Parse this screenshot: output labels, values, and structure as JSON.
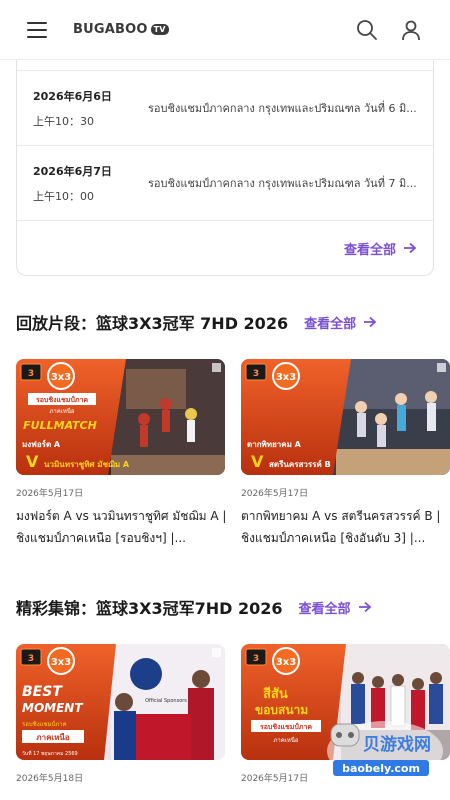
{
  "header": {
    "logo_text": "BUGABOO",
    "logo_badge": "TV"
  },
  "schedule": {
    "rows": [
      {
        "date": "2026年6月6日",
        "time": "上午10：30",
        "title": "รอบชิงแชมป์ภาคกลาง กรุงเทพและปริมณฑล วันที่ 6 มิ..."
      },
      {
        "date": "2026年6月7日",
        "time": "上午10：00",
        "title": "รอบชิงแชมป์ภาคกลาง กรุงเทพและปริมณฑล วันที่ 7 มิ..."
      }
    ],
    "view_all": "查看全部"
  },
  "replay": {
    "title": "回放片段：篮球3X3冠军 7HD 2026",
    "view_all": "查看全部",
    "cards": [
      {
        "date": "2026年5月17日",
        "title": "มงฟอร์ต A vs นวมินทราชูทิศ มัชฌิม A |ชิงแชมป์ภาคเหนือ [รอบชิงฯ] |...",
        "thumb": {
          "banner": "รอบชิงแชมป์ภาค",
          "region": "ภาคเหนือ",
          "tag": "FULLMATCH",
          "team1": "มงฟอร์ต A",
          "team2": "นวมินทราชูทิศ มัชฌิม A"
        }
      },
      {
        "date": "2026年5月17日",
        "title": "ตากพิทยาคม A vs สตรีนครสวรรค์ B |ชิงแชมป์ภาคเหนือ [ชิงอันดับ 3] |...",
        "thumb": {
          "team1": "ตากพิทยาคม A",
          "team2": "สตรีนครสวรรค์ B"
        }
      }
    ]
  },
  "highlights": {
    "title": "精彩集锦：篮球3X3冠军7HD 2026",
    "view_all": "查看全部",
    "cards": [
      {
        "date": "2026年5月18日",
        "thumb": {
          "tag1": "BEST",
          "tag2": "MOMENT",
          "banner": "รอบชิงแชมป์ภาค",
          "region": "ภาคเหนือ",
          "caption": "วันที่ 17 พฤษภาคม 2569",
          "sponsor": "Official Sponsors"
        }
      },
      {
        "date": "2026年5月17日",
        "thumb": {
          "line1": "สีสัน",
          "line2": "ขอบสนาม",
          "banner": "รอบชิงแชมป์ภาค",
          "region": "ภาคเหนือ"
        }
      }
    ]
  },
  "watermark": {
    "text1": "贝游戏网",
    "text2": "baobely.com"
  },
  "colors": {
    "accent": "#7b4fd6",
    "thumb_orange": "#e4521c",
    "thumb_dark": "#b8300e",
    "yellow": "#ffd41a"
  }
}
